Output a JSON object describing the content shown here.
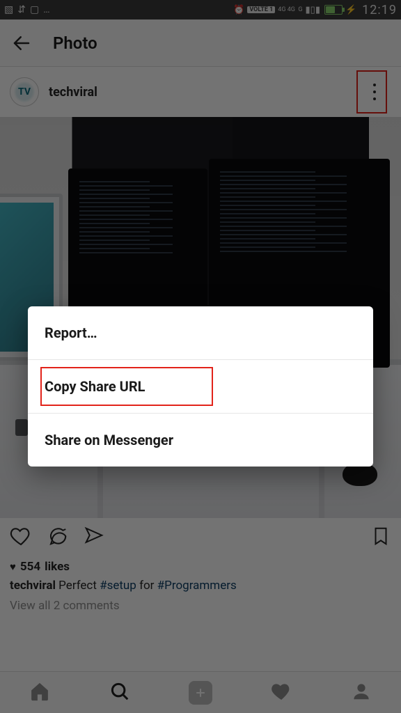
{
  "status_bar": {
    "notif_glyphs": "▣ ↕ ⊞ …",
    "volte": "VOLTE 1",
    "signal_labels": "4G 4G  G",
    "time": "12:19"
  },
  "header": {
    "title": "Photo"
  },
  "post": {
    "username": "techviral",
    "avatar_initials": "TV"
  },
  "actions": {
    "like_icon": "heart-icon",
    "comment_icon": "comment-icon",
    "share_icon": "send-icon",
    "bookmark_icon": "bookmark-icon"
  },
  "meta": {
    "likes_count": "554",
    "likes_word": "likes",
    "caption_user": "techviral",
    "caption_text_1": " Perfect ",
    "caption_hashtag_1": "#setup",
    "caption_text_2": " for ",
    "caption_hashtag_2": "#Programmers",
    "view_comments": "View all 2 comments"
  },
  "sheet": {
    "items": [
      {
        "label": "Report…"
      },
      {
        "label": "Copy Share URL",
        "highlighted": true
      },
      {
        "label": "Share on Messenger"
      }
    ]
  },
  "nav": {
    "active": "search"
  }
}
